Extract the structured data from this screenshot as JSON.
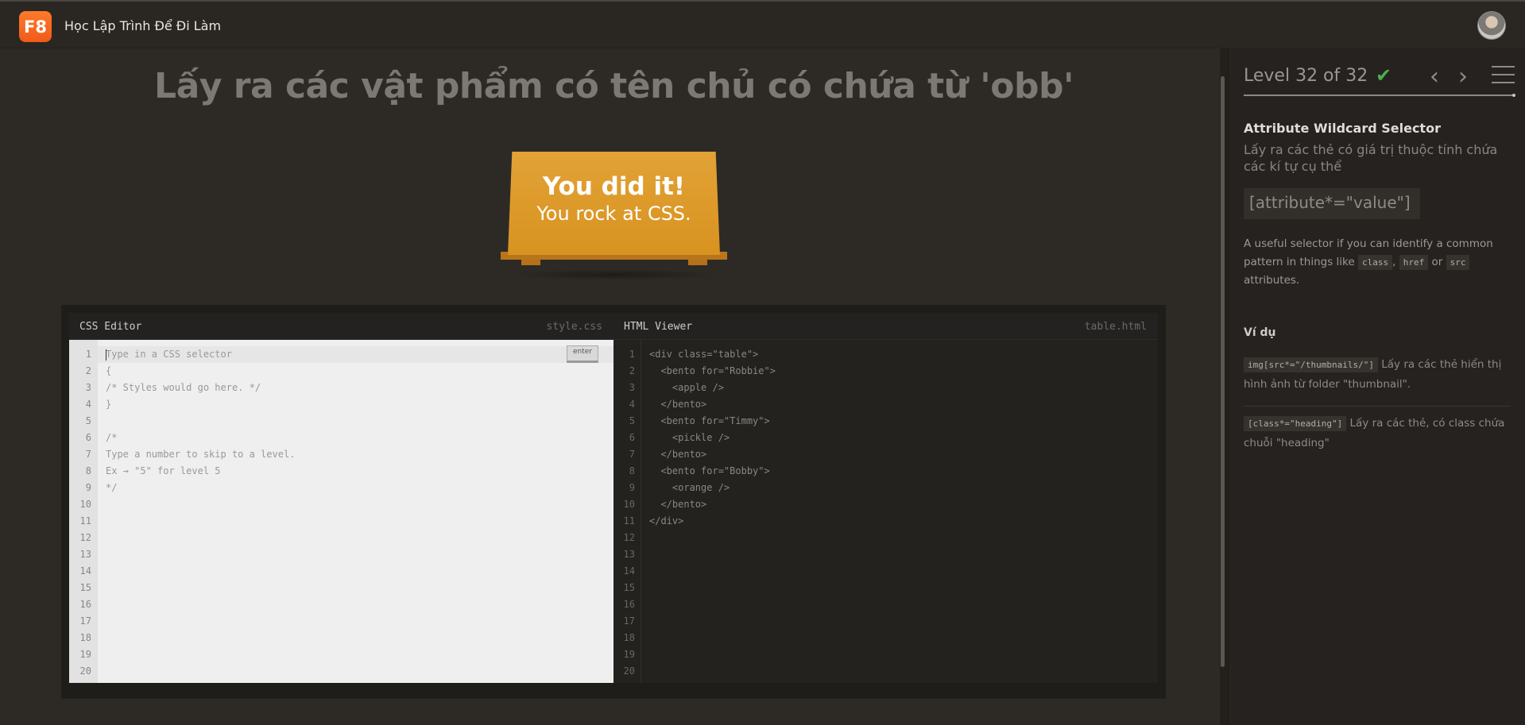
{
  "topbar": {
    "logo_text": "F8",
    "brand": "Học Lập Trình Để Đi Làm"
  },
  "main": {
    "level_instruction": "Lấy ra các vật phẩm có tên chủ có chứa từ 'obb'",
    "win_line_1": "You did it!",
    "win_line_2": "You rock at CSS."
  },
  "css_editor": {
    "title": "CSS Editor",
    "filename": "style.css",
    "enter_label": "enter",
    "lines": [
      "Type in a CSS selector",
      "{",
      "/* Styles would go here. */",
      "}",
      "",
      "/*",
      "Type a number to skip to a level.",
      "Ex → \"5\" for level 5",
      "*/",
      "",
      "",
      "",
      "",
      "",
      "",
      "",
      "",
      "",
      "",
      ""
    ]
  },
  "html_viewer": {
    "title": "HTML Viewer",
    "filename": "table.html",
    "lines": [
      "<div class=\"table\">",
      "  <bento for=\"Robbie\">",
      "    <apple />",
      "  </bento>",
      "  <bento for=\"Timmy\">",
      "    <pickle />",
      "  </bento>",
      "  <bento for=\"Bobby\">",
      "    <orange />",
      "  </bento>",
      "</div>",
      "",
      "",
      "",
      "",
      "",
      "",
      "",
      "",
      ""
    ]
  },
  "sidebar": {
    "level_text": "Level 32 of 32",
    "check_icon": "check-icon",
    "selector_name": "Attribute Wildcard Selector",
    "selector_desc": "Lấy ra các thẻ có giá trị thuộc tính chứa các kí tự cụ thể",
    "syntax": "[attribute*=\"value\"]",
    "hint_part1": "A useful selector if you can identify a common pattern in things like ",
    "hint_code1": "class",
    "hint_sep1": ", ",
    "hint_code2": "href",
    "hint_sep2": " or ",
    "hint_code3": "src",
    "hint_part2": " attributes.",
    "examples_heading": "Ví dụ",
    "examples": [
      {
        "code": "img[src*=\"/thumbnails/\"]",
        "text": " Lấy ra các thẻ hiển thị hình ảnh từ folder \"thumbnail\"."
      },
      {
        "code": "[class*=\"heading\"]",
        "text": " Lấy ra các thẻ, có class chứa chuỗi \"heading\""
      }
    ]
  },
  "colors": {
    "accent": "#f05a1a",
    "table": "#d89320",
    "check": "#4caf50"
  }
}
